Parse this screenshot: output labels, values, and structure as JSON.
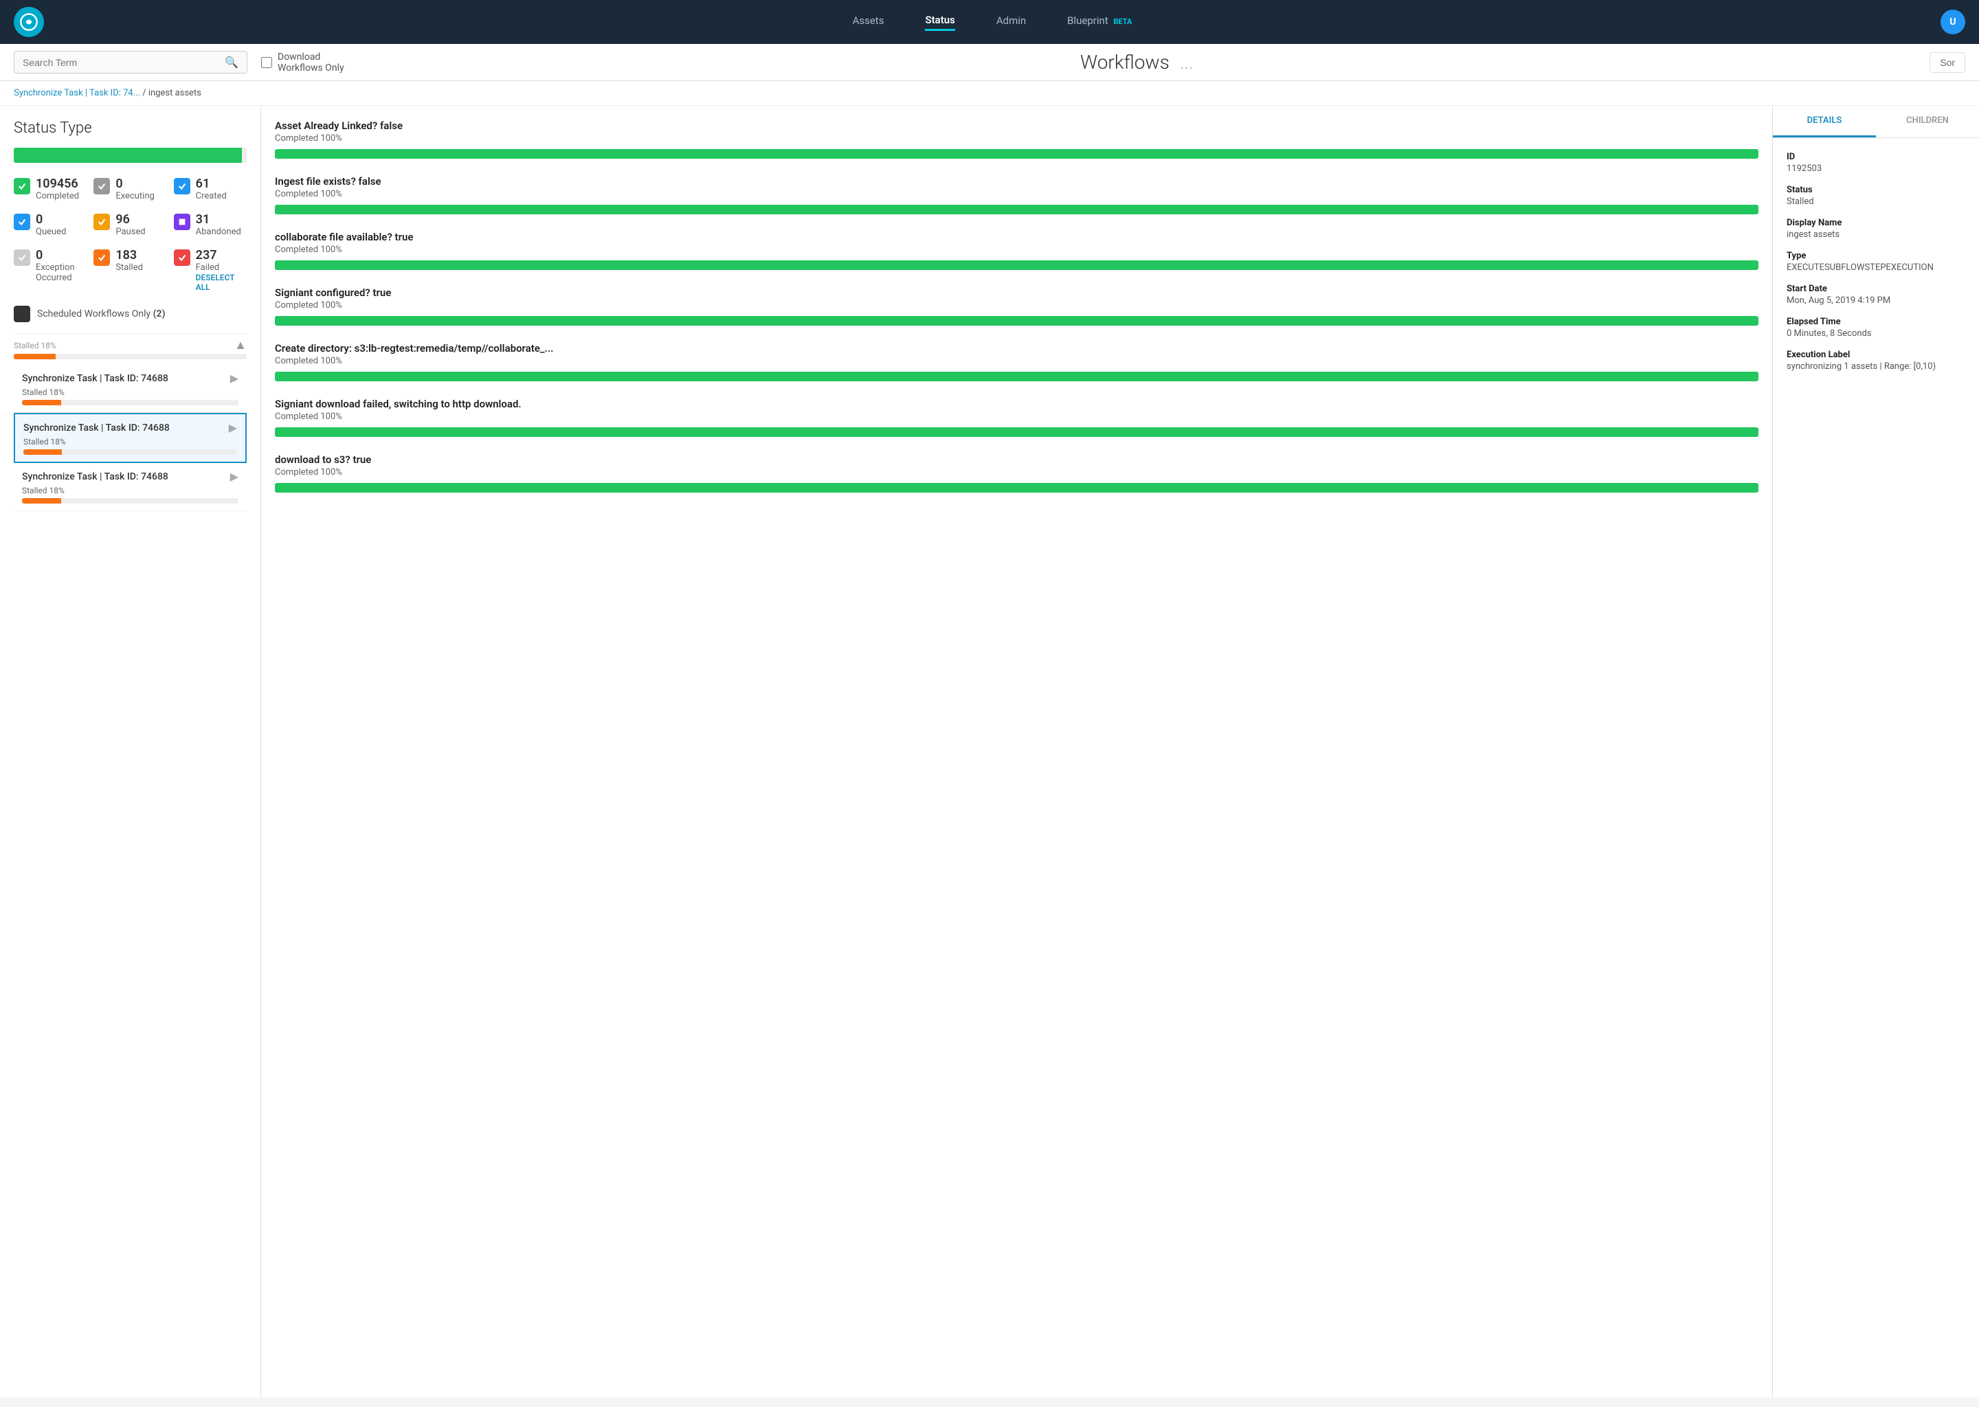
{
  "nav": {
    "links": [
      {
        "label": "Assets",
        "active": false
      },
      {
        "label": "Status",
        "active": true
      },
      {
        "label": "Admin",
        "active": false
      },
      {
        "label": "Blueprint",
        "active": false,
        "beta": "BETA"
      }
    ]
  },
  "toolbar": {
    "search_placeholder": "Search Term",
    "download_label": "Download\nWorkflows Only",
    "workflows_title": "Workflows",
    "workflows_dots": "...",
    "sort_label": "Sor"
  },
  "breadcrumb": {
    "link_text": "Synchronize Task | Task ID: 74...",
    "separator": " / ",
    "current": "ingest assets"
  },
  "left_panel": {
    "title": "Status Type",
    "progress_pct": 98,
    "statuses": [
      {
        "num": "109456",
        "label": "Completed",
        "icon_type": "green",
        "col": 1
      },
      {
        "num": "0",
        "label": "Executing",
        "icon_type": "gray",
        "col": 2
      },
      {
        "num": "61",
        "label": "Created",
        "icon_type": "blue",
        "col": 3
      },
      {
        "num": "0",
        "label": "Queued",
        "icon_type": "blue-check",
        "col": 1
      },
      {
        "num": "96",
        "label": "Paused",
        "icon_type": "yellow",
        "col": 2
      },
      {
        "num": "31",
        "label": "Abandoned",
        "icon_type": "purple",
        "col": 3
      },
      {
        "num": "0",
        "label": "Exception\nOccurred",
        "icon_type": "lightgray",
        "col": 1
      },
      {
        "num": "183",
        "label": "Stalled",
        "icon_type": "orange",
        "col": 2
      },
      {
        "num": "237",
        "label": "Failed",
        "icon_type": "red",
        "col": 3
      }
    ],
    "deselect_all": "DESELECT ALL",
    "scheduled_label": "Scheduled Workflows Only",
    "scheduled_count": "(2)",
    "workflow_items": [
      {
        "title": "Synchronize Task | Task ID: 74688",
        "status": "Stalled 18%",
        "progress": 18,
        "selected": false
      },
      {
        "title": "Synchronize Task | Task ID: 74688",
        "status": "Stalled 18%",
        "progress": 18,
        "selected": true
      },
      {
        "title": "Synchronize Task | Task ID: 74688",
        "status": "Stalled 18%",
        "progress": 18,
        "selected": false
      }
    ]
  },
  "middle_panel": {
    "steps": [
      {
        "title": "Asset Already Linked? false",
        "subtitle": "Completed 100%",
        "progress": 100
      },
      {
        "title": "Ingest file exists? false",
        "subtitle": "Completed 100%",
        "progress": 100
      },
      {
        "title": "collaborate file available? true",
        "subtitle": "Completed 100%",
        "progress": 100
      },
      {
        "title": "Signiant configured? true",
        "subtitle": "Completed 100%",
        "progress": 100
      },
      {
        "title": "Create directory: s3:lb-regtest:remedia/temp//collaborate_...",
        "subtitle": "Completed 100%",
        "progress": 100
      },
      {
        "title": "Signiant download failed, switching to http download.",
        "subtitle": "Completed 100%",
        "progress": 100
      },
      {
        "title": "download to s3? true",
        "subtitle": "Completed 100%",
        "progress": 100
      }
    ]
  },
  "right_panel": {
    "tabs": [
      {
        "label": "DETAILS",
        "active": true
      },
      {
        "label": "CHILDREN",
        "active": false
      }
    ],
    "details": {
      "id_label": "ID",
      "id_value": "1192503",
      "status_label": "Status",
      "status_value": "Stalled",
      "display_name_label": "Display Name",
      "display_name_value": "ingest assets",
      "type_label": "Type",
      "type_value": "EXECUTESUBFLOWSTEPEXECUTION",
      "start_date_label": "Start Date",
      "start_date_value": "Mon, Aug 5, 2019 4:19 PM",
      "elapsed_label": "Elapsed Time",
      "elapsed_value": "0 Minutes, 8 Seconds",
      "execution_label": "Execution Label",
      "execution_value": "synchronizing 1 assets | Range: [0,10)"
    }
  }
}
